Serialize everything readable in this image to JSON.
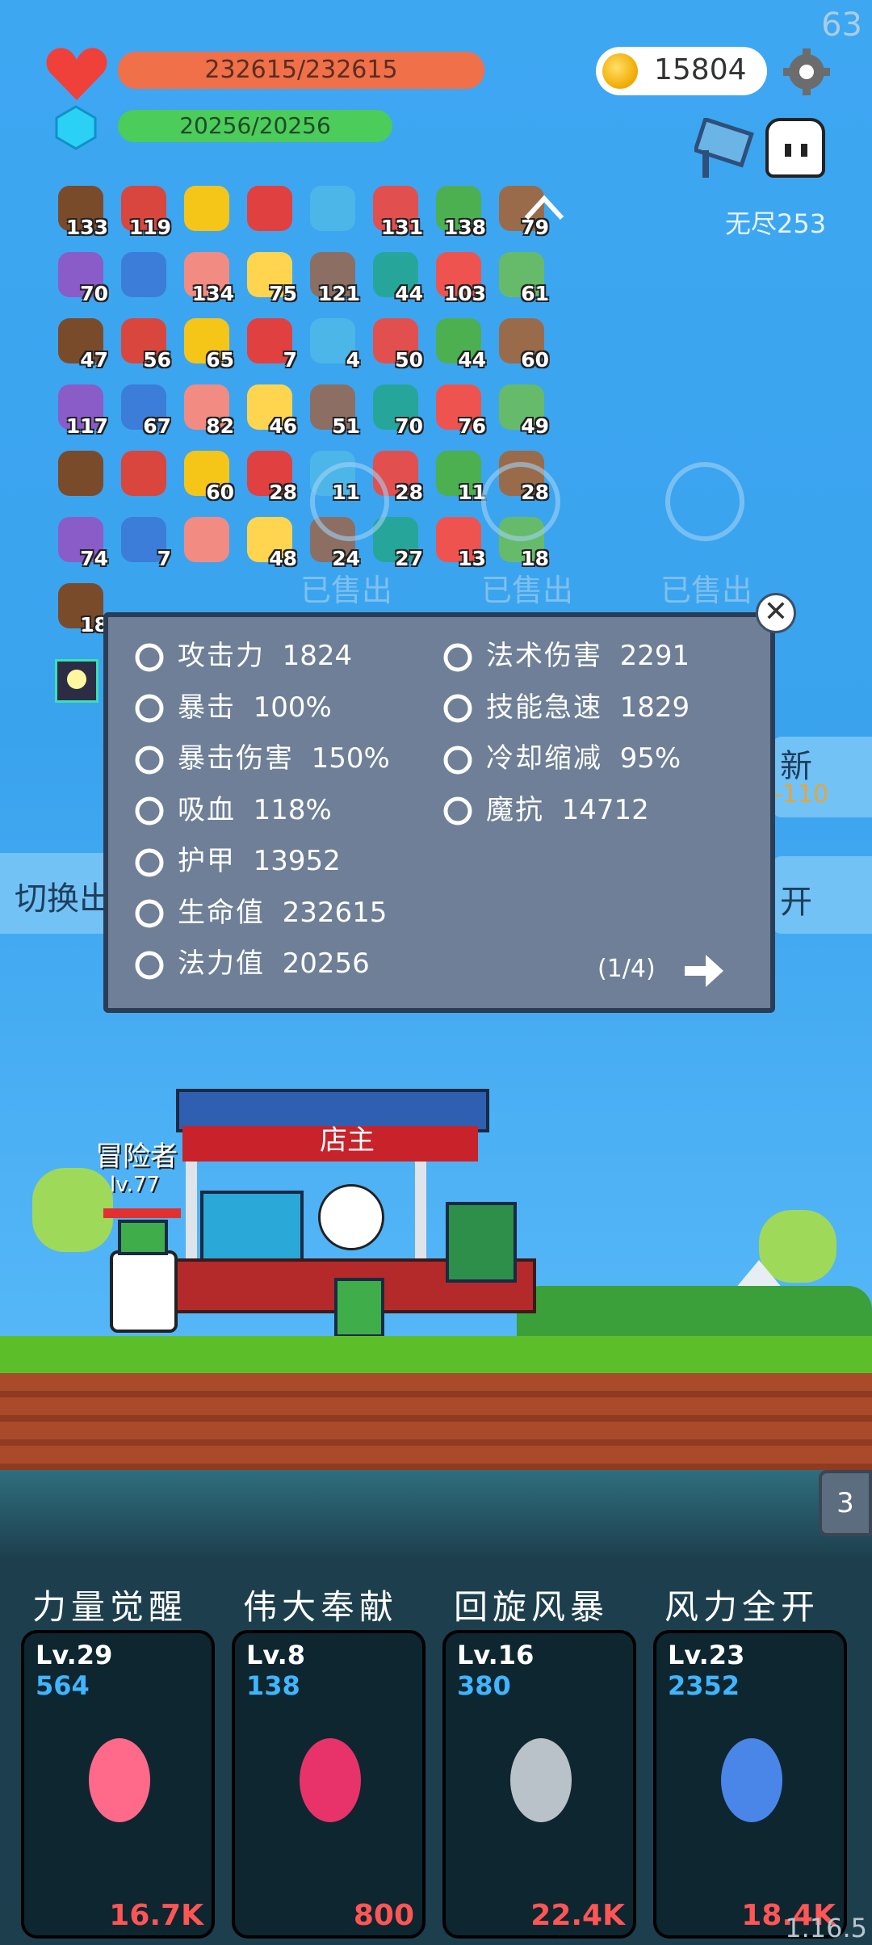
{
  "hud": {
    "fps": "63",
    "hp_text": "232615/232615",
    "mp_text": "20256/20256",
    "coins": "15804",
    "stage_label": "无尽253"
  },
  "items": {
    "rows": [
      [
        "133",
        "119",
        "",
        "",
        "",
        "131",
        "138",
        "79"
      ],
      [
        "70",
        "",
        "134",
        "75",
        "121",
        "44",
        "103",
        "61"
      ],
      [
        "47",
        "56",
        "65",
        "7",
        "4",
        "50",
        "44",
        "60"
      ],
      [
        "117",
        "67",
        "82",
        "46",
        "51",
        "70",
        "76",
        "49"
      ],
      [
        "",
        "",
        "60",
        "28",
        "11",
        "28",
        "11",
        "28"
      ],
      [
        "74",
        "7",
        "",
        "48",
        "24",
        "27",
        "13",
        "18"
      ],
      [
        "18"
      ]
    ]
  },
  "shop": {
    "sold_label": "已售出",
    "side_refresh": "新",
    "side_refresh_cost": "-110",
    "side_switch": "切换出",
    "side_open": "开"
  },
  "stats": {
    "left": [
      {
        "label": "攻击力",
        "value": "1824"
      },
      {
        "label": "暴击",
        "value": "100%"
      },
      {
        "label": "暴击伤害",
        "value": "150%"
      },
      {
        "label": "吸血",
        "value": "118%"
      },
      {
        "label": "护甲",
        "value": "13952"
      },
      {
        "label": "生命值",
        "value": "232615"
      },
      {
        "label": "法力值",
        "value": "20256"
      }
    ],
    "right": [
      {
        "label": "法术伤害",
        "value": "2291"
      },
      {
        "label": "技能急速",
        "value": "1829"
      },
      {
        "label": "冷却缩减",
        "value": "95%"
      },
      {
        "label": "魔抗",
        "value": "14712"
      }
    ],
    "page": "(1/4)"
  },
  "scene": {
    "shopkeeper_label": "店主",
    "adventurer_label": "冒险者",
    "adventurer_level": "lv.77",
    "side_count": "3"
  },
  "skills": [
    {
      "name": "力量觉醒",
      "level": "Lv.29",
      "cost": "564",
      "price": "16.7K",
      "color": "#ff6a8a"
    },
    {
      "name": "伟大奉献",
      "level": "Lv.8",
      "cost": "138",
      "price": "800",
      "color": "#e8336a"
    },
    {
      "name": "回旋风暴",
      "level": "Lv.16",
      "cost": "380",
      "price": "22.4K",
      "color": "#b9c2c8"
    },
    {
      "name": "风力全开",
      "level": "Lv.23",
      "cost": "2352",
      "price": "18.4K",
      "color": "#4a86e8"
    }
  ],
  "version": "1.16.5",
  "colors": {
    "hp_bar": "#f0704a",
    "mp_bar": "#4ccc5a",
    "panel": "#6e7f97",
    "price": "#ff5555",
    "cost": "#3fb6ff"
  }
}
